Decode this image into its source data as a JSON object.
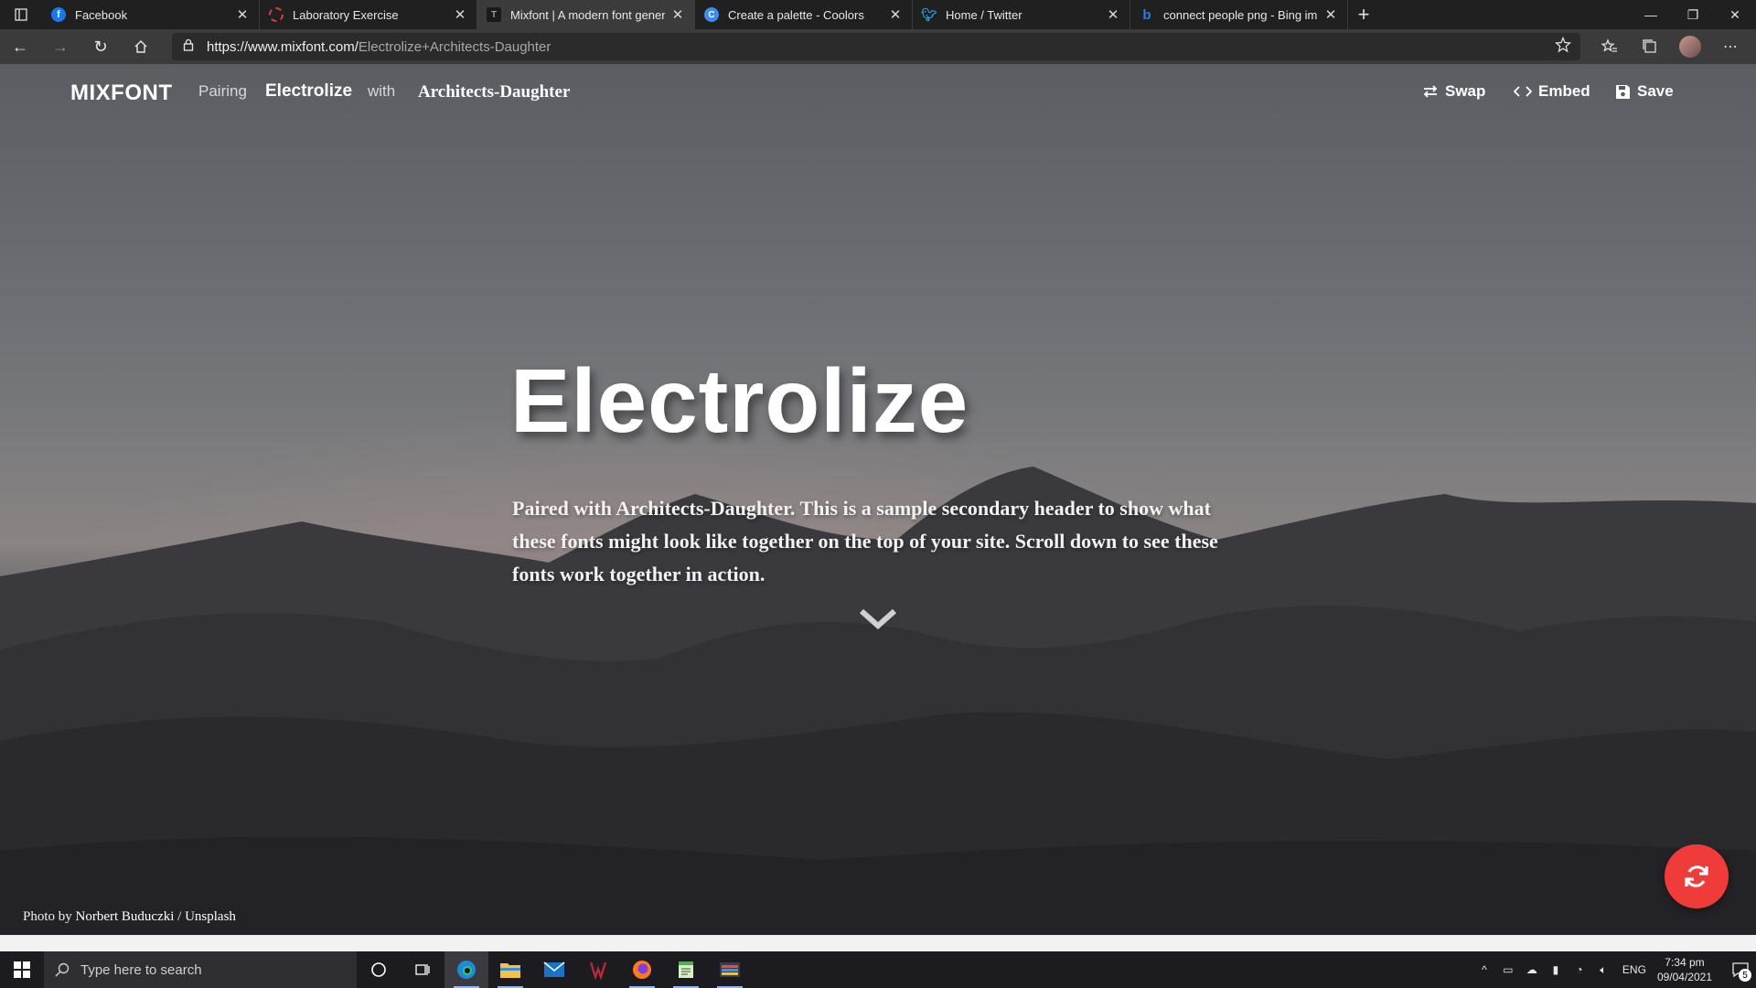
{
  "browser": {
    "tabs": [
      {
        "title": "Facebook",
        "icon": "facebook-icon",
        "color": "#1877f2",
        "active": false
      },
      {
        "title": "Laboratory Exercise",
        "icon": "circle-dashed-icon",
        "color": "#e33b3b",
        "active": false
      },
      {
        "title": "Mixfont | A modern font generat",
        "icon": "mixfont-icon",
        "color": "#444444",
        "active": true
      },
      {
        "title": "Create a palette - Coolors",
        "icon": "coolors-icon",
        "color": "#3c8cf0",
        "active": false
      },
      {
        "title": "Home / Twitter",
        "icon": "twitter-icon",
        "color": "#1da1f2",
        "active": false
      },
      {
        "title": "connect people png - Bing imag",
        "icon": "bing-icon",
        "color": "#2d7de0",
        "active": false
      }
    ],
    "url_host": "https://www.mixfont.com/",
    "url_path": "Electrolize+Architects-Daughter"
  },
  "site": {
    "logo": "MIXFONT",
    "pairing_label": "Pairing",
    "font_a": "Electrolize",
    "with_label": "with",
    "font_b": "Architects-Daughter",
    "actions": {
      "swap": "Swap",
      "embed": "Embed",
      "save": "Save"
    }
  },
  "hero": {
    "title": "Electrolize",
    "subtitle": "Paired with Architects-Daughter. This is a sample secondary header to show what these fonts might look like together on the top of your site. Scroll down to see these fonts work together in action."
  },
  "credit": {
    "prefix": "Photo by ",
    "author": "Norbert Buduczki",
    "separator": " / ",
    "source": "Unsplash"
  },
  "accent_color": "#ef3b3a",
  "taskbar": {
    "search_placeholder": "Type here to search",
    "language": "ENG",
    "time": "7:34 pm",
    "date": "09/04/2021",
    "notification_count": "5"
  }
}
